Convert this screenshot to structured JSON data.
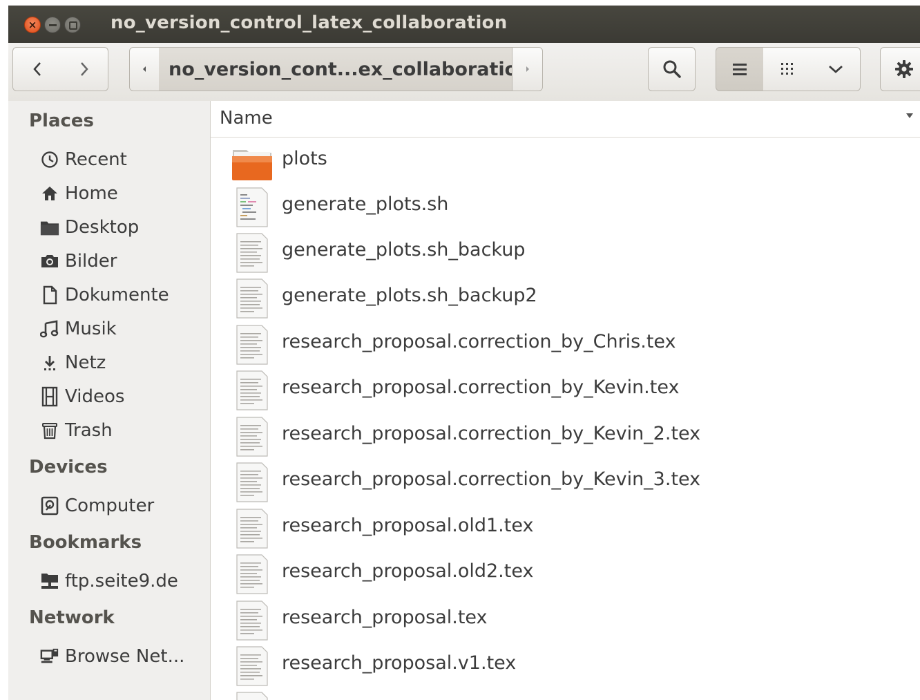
{
  "window": {
    "title": "no_version_control_latex_collaboration"
  },
  "toolbar": {
    "path_current": "no_version_cont...ex_collaboration"
  },
  "sidebar": {
    "places_title": "Places",
    "places": [
      {
        "label": "Recent",
        "icon": "clock-icon"
      },
      {
        "label": "Home",
        "icon": "home-icon"
      },
      {
        "label": "Desktop",
        "icon": "folder-icon"
      },
      {
        "label": "Bilder",
        "icon": "camera-icon"
      },
      {
        "label": "Dokumente",
        "icon": "document-icon"
      },
      {
        "label": "Musik",
        "icon": "music-note-icon"
      },
      {
        "label": "Netz",
        "icon": "download-icon"
      },
      {
        "label": "Videos",
        "icon": "film-icon"
      },
      {
        "label": "Trash",
        "icon": "trash-icon"
      }
    ],
    "devices_title": "Devices",
    "devices": [
      {
        "label": "Computer",
        "icon": "drive-icon"
      }
    ],
    "bookmarks_title": "Bookmarks",
    "bookmarks": [
      {
        "label": "ftp.seite9.de",
        "icon": "network-drive-icon"
      }
    ],
    "network_title": "Network",
    "network": [
      {
        "label": "Browse Net...",
        "icon": "network-icon"
      }
    ]
  },
  "main": {
    "column_name": "Name",
    "files": [
      {
        "name": "plots",
        "type": "folder"
      },
      {
        "name": "generate_plots.sh",
        "type": "script"
      },
      {
        "name": "generate_plots.sh_backup",
        "type": "text"
      },
      {
        "name": "generate_plots.sh_backup2",
        "type": "text"
      },
      {
        "name": "research_proposal.correction_by_Chris.tex",
        "type": "text"
      },
      {
        "name": "research_proposal.correction_by_Kevin.tex",
        "type": "text"
      },
      {
        "name": "research_proposal.correction_by_Kevin_2.tex",
        "type": "text"
      },
      {
        "name": "research_proposal.correction_by_Kevin_3.tex",
        "type": "text"
      },
      {
        "name": "research_proposal.old1.tex",
        "type": "text"
      },
      {
        "name": "research_proposal.old2.tex",
        "type": "text"
      },
      {
        "name": "research_proposal.tex",
        "type": "text"
      },
      {
        "name": "research_proposal.v1.tex",
        "type": "text"
      }
    ]
  },
  "colors": {
    "close_button": "#dd4814",
    "titlebar": "#3b3a34",
    "folder_orange": "#e8681f",
    "sidebar_bg": "#f0efed"
  }
}
